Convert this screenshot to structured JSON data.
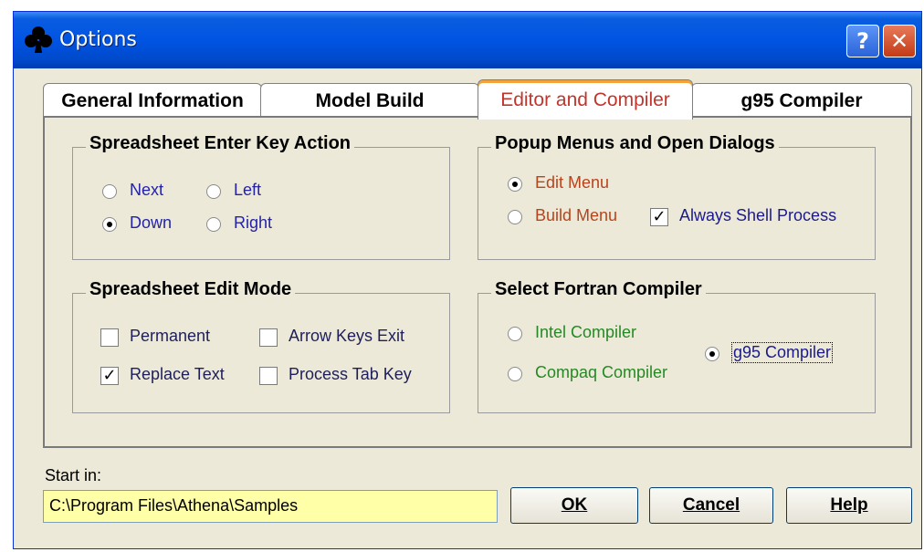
{
  "window": {
    "title": "Options",
    "app_icon": "club-icon"
  },
  "titlebar_buttons": {
    "help": "?",
    "close": "✕"
  },
  "tabs": [
    {
      "label": "General Information",
      "active": false
    },
    {
      "label": "Model Build",
      "active": false
    },
    {
      "label": "Editor and Compiler",
      "active": true
    },
    {
      "label": "g95 Compiler",
      "active": false
    }
  ],
  "enter_key": {
    "title": "Spreadsheet Enter Key Action",
    "next": "Next",
    "left": "Left",
    "down": "Down",
    "right": "Right",
    "selected": "Down"
  },
  "popup": {
    "title": "Popup Menus and Open Dialogs",
    "edit_menu": "Edit Menu",
    "build_menu": "Build Menu",
    "always_shell": "Always Shell Process",
    "selected": "Edit Menu",
    "always_shell_checked": true
  },
  "edit_mode": {
    "title": "Spreadsheet Edit Mode",
    "permanent": "Permanent",
    "arrow_keys_exit": "Arrow Keys Exit",
    "replace_text": "Replace Text",
    "process_tab_key": "Process Tab Key",
    "checked": [
      "Replace Text"
    ]
  },
  "compiler": {
    "title": "Select Fortran Compiler",
    "intel": "Intel Compiler",
    "compaq": "Compaq Compiler",
    "g95": "g95 Compiler",
    "selected": "g95 Compiler"
  },
  "start_in": {
    "label": "Start in:",
    "value": "C:\\Program Files\\Athena\\Samples"
  },
  "buttons": {
    "ok": "OK",
    "cancel": "Cancel",
    "help": "Help"
  },
  "colors": {
    "title_bar": "#0054e3",
    "path_field_bg": "#ffffa8",
    "active_tab_text": "#c0362c"
  }
}
